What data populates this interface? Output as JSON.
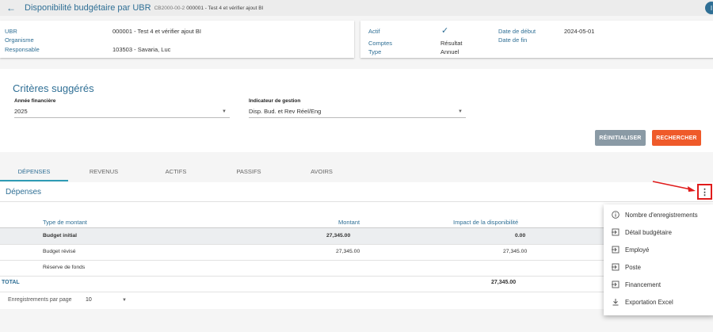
{
  "header": {
    "back_icon": "arrow-left-icon",
    "title": "Disponibilité budgétaire par UBR",
    "code": "CB2000-00-2",
    "subtitle": "000001 - Test 4 et vérifier ajout BI",
    "avatar": "I"
  },
  "info_left": {
    "ubr_label": "UBR",
    "ubr_value": "000001 - Test 4 et vérifier ajout BI",
    "org_label": "Organisme",
    "resp_label": "Responsable",
    "resp_value": "103503 - Savaria, Luc"
  },
  "info_right": {
    "actif_label": "Actif",
    "actif_icon": "checkmark-icon",
    "comptes_label": "Comptes",
    "comptes_value": "Résultat",
    "type_label": "Type",
    "type_value": "Annuel",
    "date_debut_label": "Date de début",
    "date_debut_value": "2024-05-01",
    "date_fin_label": "Date de fin"
  },
  "criteria": {
    "title": "Critères suggérés",
    "year_label": "Année financière",
    "year_value": "2025",
    "indicator_label": "Indicateur de gestion",
    "indicator_value": "Disp. Bud. et Rev Réel/Eng",
    "reset_label": "RÉINITIALISER",
    "search_label": "RECHERCHER"
  },
  "tabs": [
    "DÉPENSES",
    "REVENUS",
    "ACTIFS",
    "PASSIFS",
    "AVOIRS"
  ],
  "section": {
    "title": "Dépenses",
    "menu_icon": "kebab-menu-icon"
  },
  "table": {
    "headers": [
      "Type de montant",
      "Montant",
      "Impact de la disponibilité"
    ],
    "rows": [
      {
        "type": "Budget initial",
        "montant": "27,345.00",
        "impact": "0.00"
      },
      {
        "type": "Budget révisé",
        "montant": "27,345.00",
        "impact": "27,345.00"
      },
      {
        "type": "Réserve de fonds",
        "montant": "",
        "impact": ""
      }
    ],
    "total_label": "TOTAL",
    "total_impact": "27,345.00"
  },
  "pager": {
    "label": "Enregistrements par page",
    "value": "10"
  },
  "menu": {
    "items": [
      {
        "label": "Nombre d'enregistrements",
        "icon": "info-icon"
      },
      {
        "label": "Détail budgétaire",
        "icon": "open-in-icon"
      },
      {
        "label": "Employé",
        "icon": "open-in-icon"
      },
      {
        "label": "Poste",
        "icon": "open-in-icon"
      },
      {
        "label": "Financement",
        "icon": "open-in-icon"
      },
      {
        "label": "Exportation Excel",
        "icon": "download-icon"
      }
    ]
  },
  "colors": {
    "primary": "#2f6f95",
    "accent": "#ef5a2a",
    "reset_button": "#8a9aa5",
    "highlight_box": "#e01b1b"
  }
}
